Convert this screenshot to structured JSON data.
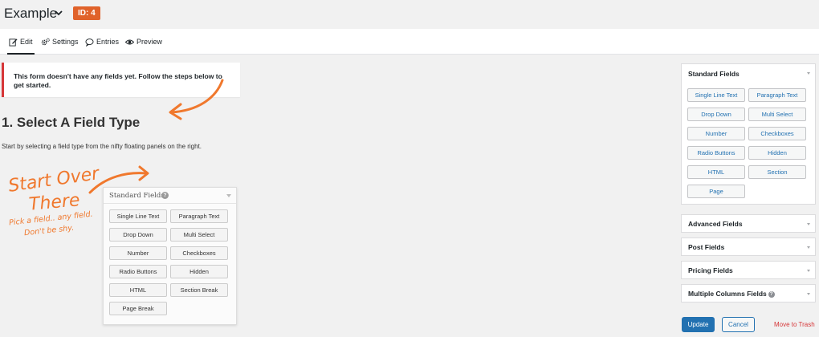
{
  "header": {
    "title": "Example",
    "id_badge": "ID: 4",
    "badge_color": "#e0622a"
  },
  "tabs": [
    {
      "label": "Edit",
      "icon": "pencil-square-icon",
      "active": true
    },
    {
      "label": "Settings",
      "icon": "gears-icon",
      "active": false
    },
    {
      "label": "Entries",
      "icon": "speech-bubble-icon",
      "active": false
    },
    {
      "label": "Preview",
      "icon": "eye-icon",
      "active": false
    }
  ],
  "notice": {
    "text": "This form doesn't have any fields yet. Follow the steps below to get started."
  },
  "step": {
    "title": "1. Select A Field Type",
    "description": "Start by selecting a field type from the nifty floating panels on the right."
  },
  "annotation": {
    "line1": "Start Over",
    "line2": "There",
    "line3": "Pick a field.. any field.",
    "line4": "Don't be shy.",
    "color": "#f0782d"
  },
  "mini_panel": {
    "title": "Standard Fields",
    "buttons": [
      "Single Line Text",
      "Paragraph Text",
      "Drop Down",
      "Multi Select",
      "Number",
      "Checkboxes",
      "Radio Buttons",
      "Hidden",
      "HTML",
      "Section Break",
      "Page Break"
    ]
  },
  "sidebar": {
    "standard": {
      "title": "Standard Fields",
      "buttons": [
        "Single Line Text",
        "Paragraph Text",
        "Drop Down",
        "Multi Select",
        "Number",
        "Checkboxes",
        "Radio Buttons",
        "Hidden",
        "HTML",
        "Section",
        "Page"
      ]
    },
    "advanced": "Advanced Fields",
    "post": "Post Fields",
    "pricing": "Pricing Fields",
    "multi_columns": "Multiple Columns Fields"
  },
  "actions": {
    "update": "Update",
    "cancel": "Cancel",
    "trash": "Move to Trash"
  }
}
